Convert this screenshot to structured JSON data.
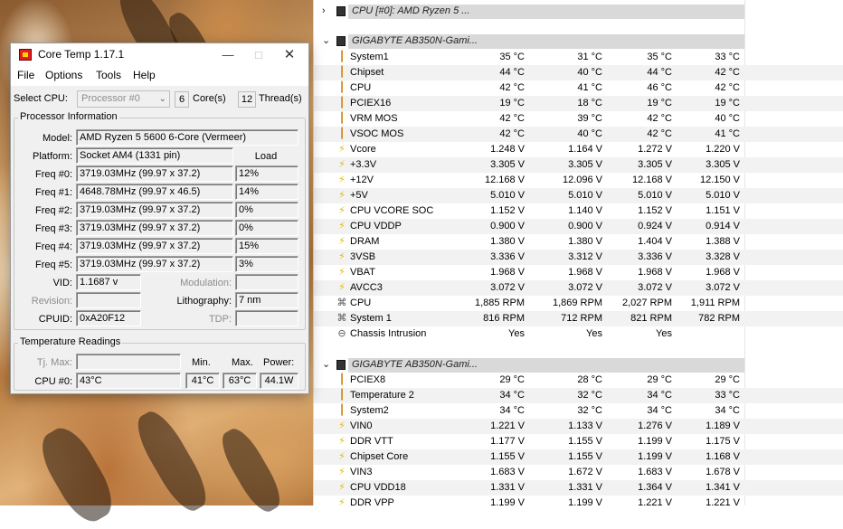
{
  "coretemp": {
    "title": "Core Temp 1.17.1",
    "menu": [
      "File",
      "Options",
      "Tools",
      "Help"
    ],
    "select_cpu_label": "Select CPU:",
    "select_cpu_value": "Processor #0",
    "cores_count": "6",
    "cores_label": "Core(s)",
    "threads_count": "12",
    "threads_label": "Thread(s)",
    "proc_info_title": "Processor Information",
    "model_label": "Model:",
    "model_value": "AMD Ryzen 5 5600 6-Core (Vermeer)",
    "platform_label": "Platform:",
    "platform_value": "Socket AM4 (1331 pin)",
    "load_header": "Load",
    "freqs": [
      {
        "label": "Freq #0:",
        "value": "3719.03MHz (99.97 x 37.2)",
        "load": "12%"
      },
      {
        "label": "Freq #1:",
        "value": "4648.78MHz (99.97 x 46.5)",
        "load": "14%"
      },
      {
        "label": "Freq #2:",
        "value": "3719.03MHz (99.97 x 37.2)",
        "load": "0%"
      },
      {
        "label": "Freq #3:",
        "value": "3719.03MHz (99.97 x 37.2)",
        "load": "0%"
      },
      {
        "label": "Freq #4:",
        "value": "3719.03MHz (99.97 x 37.2)",
        "load": "15%"
      },
      {
        "label": "Freq #5:",
        "value": "3719.03MHz (99.97 x 37.2)",
        "load": "3%"
      }
    ],
    "vid_label": "VID:",
    "vid_value": "1.1687 v",
    "modulation_label": "Modulation:",
    "revision_label": "Revision:",
    "lithography_label": "Lithography:",
    "lithography_value": "7 nm",
    "cpuid_label": "CPUID:",
    "cpuid_value": "0xA20F12",
    "tdp_label": "TDP:",
    "temp_title": "Temperature Readings",
    "tjmax_label": "Tj. Max:",
    "min_header": "Min.",
    "max_header": "Max.",
    "power_header": "Power:",
    "cpu0_label": "CPU #0:",
    "cpu0_temp": "43°C",
    "cpu0_min": "41°C",
    "cpu0_max": "63°C",
    "cpu0_power": "44.1W"
  },
  "sensors": {
    "group_collapsed": "CPU [#0]: AMD Ryzen 5 ...",
    "group1_title": "GIGABYTE AB350N-Gami...",
    "group1_rows": [
      {
        "icon": "thermometer-icon",
        "name": "System1",
        "v": [
          "35 °C",
          "31 °C",
          "35 °C",
          "33 °C"
        ]
      },
      {
        "icon": "thermometer-icon",
        "name": "Chipset",
        "v": [
          "44 °C",
          "40 °C",
          "44 °C",
          "42 °C"
        ]
      },
      {
        "icon": "thermometer-icon",
        "name": "CPU",
        "v": [
          "42 °C",
          "41 °C",
          "46 °C",
          "42 °C"
        ]
      },
      {
        "icon": "thermometer-icon",
        "name": "PCIEX16",
        "v": [
          "19 °C",
          "18 °C",
          "19 °C",
          "19 °C"
        ]
      },
      {
        "icon": "thermometer-icon",
        "name": "VRM MOS",
        "v": [
          "42 °C",
          "39 °C",
          "42 °C",
          "40 °C"
        ]
      },
      {
        "icon": "thermometer-icon",
        "name": "VSOC MOS",
        "v": [
          "42 °C",
          "40 °C",
          "42 °C",
          "41 °C"
        ]
      },
      {
        "icon": "lightning-icon",
        "name": "Vcore",
        "v": [
          "1.248 V",
          "1.164 V",
          "1.272 V",
          "1.220 V"
        ]
      },
      {
        "icon": "lightning-icon",
        "name": "+3.3V",
        "v": [
          "3.305 V",
          "3.305 V",
          "3.305 V",
          "3.305 V"
        ]
      },
      {
        "icon": "lightning-icon",
        "name": "+12V",
        "v": [
          "12.168 V",
          "12.096 V",
          "12.168 V",
          "12.150 V"
        ]
      },
      {
        "icon": "lightning-icon",
        "name": "+5V",
        "v": [
          "5.010 V",
          "5.010 V",
          "5.010 V",
          "5.010 V"
        ]
      },
      {
        "icon": "lightning-icon",
        "name": "CPU VCORE SOC",
        "v": [
          "1.152 V",
          "1.140 V",
          "1.152 V",
          "1.151 V"
        ]
      },
      {
        "icon": "lightning-icon",
        "name": "CPU VDDP",
        "v": [
          "0.900 V",
          "0.900 V",
          "0.924 V",
          "0.914 V"
        ]
      },
      {
        "icon": "lightning-icon",
        "name": "DRAM",
        "v": [
          "1.380 V",
          "1.380 V",
          "1.404 V",
          "1.388 V"
        ]
      },
      {
        "icon": "lightning-icon",
        "name": "3VSB",
        "v": [
          "3.336 V",
          "3.312 V",
          "3.336 V",
          "3.328 V"
        ]
      },
      {
        "icon": "lightning-icon",
        "name": "VBAT",
        "v": [
          "1.968 V",
          "1.968 V",
          "1.968 V",
          "1.968 V"
        ]
      },
      {
        "icon": "lightning-icon",
        "name": "AVCC3",
        "v": [
          "3.072 V",
          "3.072 V",
          "3.072 V",
          "3.072 V"
        ]
      },
      {
        "icon": "fan-icon",
        "name": "CPU",
        "v": [
          "1,885 RPM",
          "1,869 RPM",
          "2,027 RPM",
          "1,911 RPM"
        ]
      },
      {
        "icon": "fan-icon",
        "name": "System 1",
        "v": [
          "816 RPM",
          "712 RPM",
          "821 RPM",
          "782 RPM"
        ]
      },
      {
        "icon": "intrusion-icon",
        "name": "Chassis Intrusion",
        "v": [
          "Yes",
          "Yes",
          "Yes",
          ""
        ]
      }
    ],
    "group2_title": "GIGABYTE AB350N-Gami...",
    "group2_rows": [
      {
        "icon": "thermometer-icon",
        "name": "PCIEX8",
        "v": [
          "29 °C",
          "28 °C",
          "29 °C",
          "29 °C"
        ]
      },
      {
        "icon": "thermometer-icon",
        "name": "Temperature 2",
        "v": [
          "34 °C",
          "32 °C",
          "34 °C",
          "33 °C"
        ]
      },
      {
        "icon": "thermometer-icon",
        "name": "System2",
        "v": [
          "34 °C",
          "32 °C",
          "34 °C",
          "34 °C"
        ]
      },
      {
        "icon": "lightning-icon",
        "name": "VIN0",
        "v": [
          "1.221 V",
          "1.133 V",
          "1.276 V",
          "1.189 V"
        ]
      },
      {
        "icon": "lightning-icon",
        "name": "DDR VTT",
        "v": [
          "1.177 V",
          "1.155 V",
          "1.199 V",
          "1.175 V"
        ]
      },
      {
        "icon": "lightning-icon",
        "name": "Chipset Core",
        "v": [
          "1.155 V",
          "1.155 V",
          "1.199 V",
          "1.168 V"
        ]
      },
      {
        "icon": "lightning-icon",
        "name": "VIN3",
        "v": [
          "1.683 V",
          "1.672 V",
          "1.683 V",
          "1.678 V"
        ]
      },
      {
        "icon": "lightning-icon",
        "name": "CPU VDD18",
        "v": [
          "1.331 V",
          "1.331 V",
          "1.364 V",
          "1.341 V"
        ]
      },
      {
        "icon": "lightning-icon",
        "name": "DDR VPP",
        "v": [
          "1.199 V",
          "1.199 V",
          "1.221 V",
          "1.221 V"
        ]
      }
    ],
    "colors": {
      "temp": "#d48a1c",
      "volt": "#e6b800",
      "fan": "#555555",
      "row_alt": "#f2f2f2"
    }
  }
}
